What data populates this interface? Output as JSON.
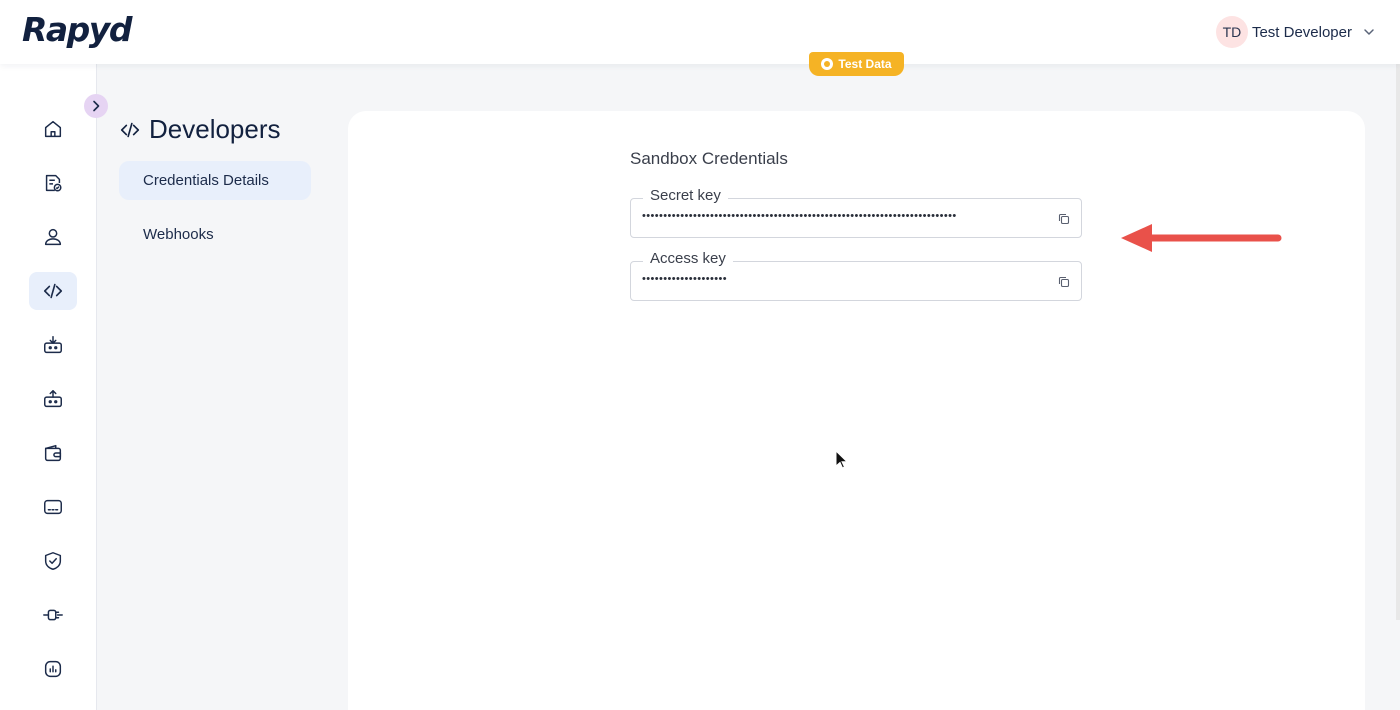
{
  "header": {
    "logo_text": "Rapyd",
    "user": {
      "initials": "TD",
      "name": "Test Developer"
    }
  },
  "badge": {
    "label": "Test Data",
    "color": "#f5b325"
  },
  "sidebar": {
    "items": [
      {
        "icon": "home-icon"
      },
      {
        "icon": "document-check-icon"
      },
      {
        "icon": "user-icon"
      },
      {
        "icon": "code-icon",
        "active": true
      },
      {
        "icon": "inbox-download-icon"
      },
      {
        "icon": "inbox-upload-icon"
      },
      {
        "icon": "wallet-icon"
      },
      {
        "icon": "card-icon"
      },
      {
        "icon": "shield-check-icon"
      },
      {
        "icon": "plug-icon"
      },
      {
        "icon": "chart-icon"
      }
    ]
  },
  "subnav": {
    "title": "Developers",
    "items": [
      {
        "label": "Credentials Details",
        "active": true
      },
      {
        "label": "Webhooks"
      }
    ]
  },
  "main": {
    "title": "Sandbox Credentials",
    "fields": [
      {
        "label": "Secret key",
        "value": "••••••••••••••••••••••••••••••••••••••••••••••••••••••••••••••••••••••••••"
      },
      {
        "label": "Access key",
        "value": "••••••••••••••••••••"
      }
    ]
  },
  "colors": {
    "brand": "#12213f",
    "annotation_arrow": "#e9514a",
    "active_bg": "#e8effb"
  }
}
